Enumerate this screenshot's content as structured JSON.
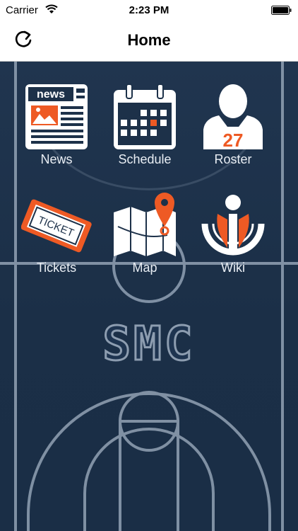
{
  "status_bar": {
    "carrier": "Carrier",
    "time": "2:23 PM"
  },
  "nav": {
    "title": "Home",
    "refresh_icon": "refresh-icon"
  },
  "tiles": [
    {
      "label": "News",
      "icon": "newspaper-icon"
    },
    {
      "label": "Schedule",
      "icon": "calendar-icon"
    },
    {
      "label": "Roster",
      "icon": "player-jersey-icon"
    },
    {
      "label": "Tickets",
      "icon": "ticket-icon"
    },
    {
      "label": "Map",
      "icon": "map-pin-icon"
    },
    {
      "label": "Wiki",
      "icon": "wiki-logo-icon"
    }
  ],
  "icon_text": {
    "news": "news",
    "jersey_number": "27",
    "ticket": "TICKET"
  },
  "court": {
    "logo_text": "SMC"
  },
  "colors": {
    "accent": "#ee5a24",
    "court_bg": "#1d3149",
    "court_lines": "#8d9db0",
    "icon_white": "#ffffff"
  }
}
